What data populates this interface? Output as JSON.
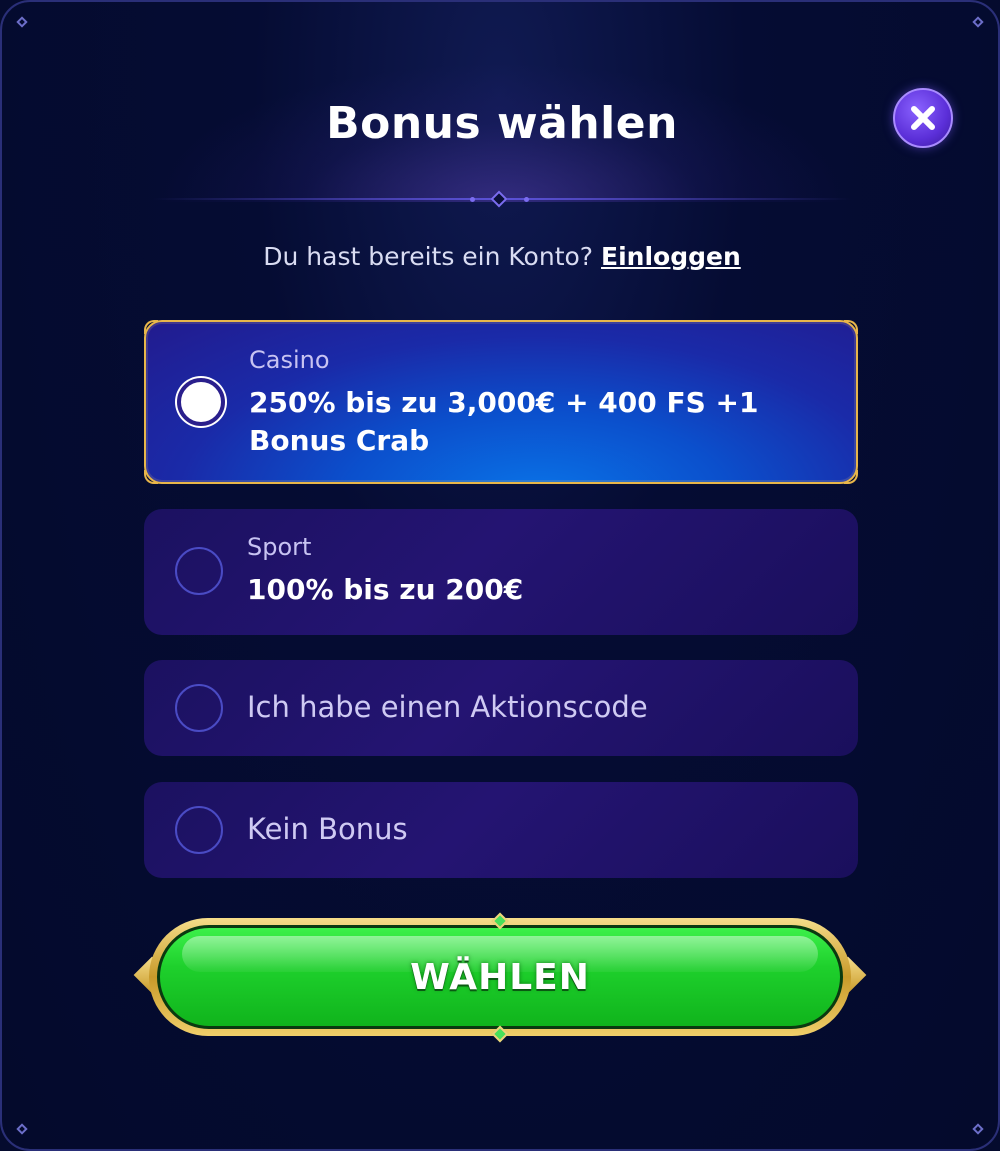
{
  "modal": {
    "title": "Bonus wählen",
    "close_icon": "close-icon"
  },
  "login": {
    "question": "Du hast bereits ein Konto?",
    "link_label": "Einloggen"
  },
  "options": [
    {
      "category": "Casino",
      "line1": "250% bis zu 3,000€ + 400 FS +1",
      "line2": "Bonus Crab",
      "selected": true
    },
    {
      "category": "Sport",
      "line1": "100% bis zu 200€",
      "selected": false
    },
    {
      "label": "Ich habe einen Aktionscode",
      "selected": false
    },
    {
      "label": "Kein Bonus",
      "selected": false
    }
  ],
  "submit": {
    "label": "WÄHLEN"
  },
  "colors": {
    "background": "#050b2e",
    "selected_gold": "#e8b64a",
    "button_green": "#1ed02c",
    "close_purple": "#5b2fd8"
  }
}
